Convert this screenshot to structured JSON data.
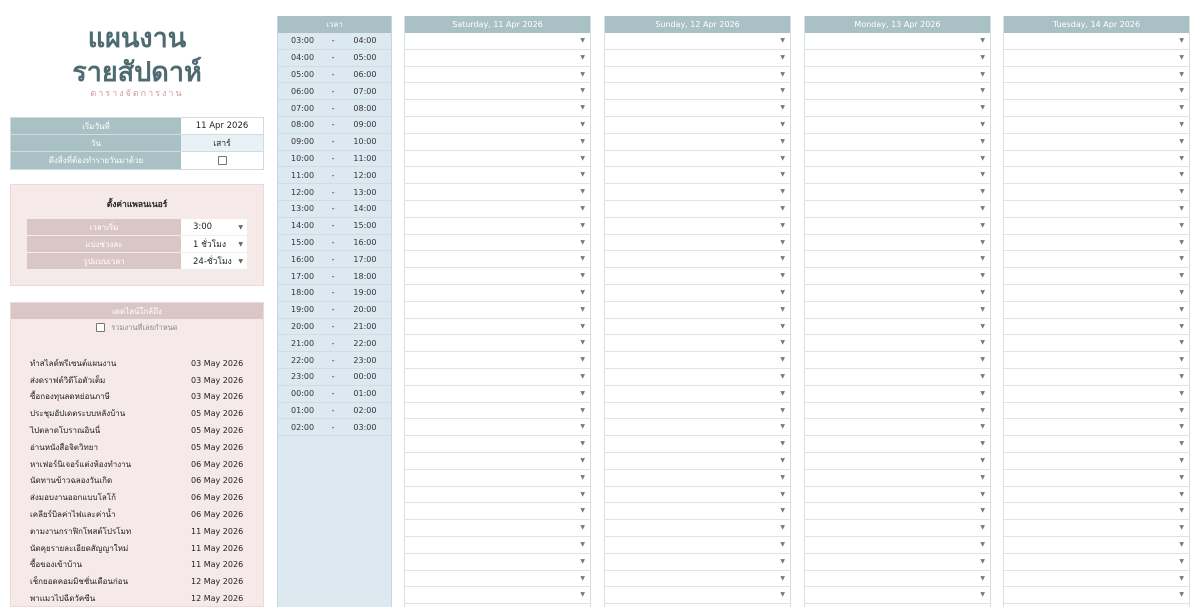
{
  "header": {
    "title_line1": "แผนงาน",
    "title_line2": "รายสัปดาห์",
    "subtitle": "ตารางจัดการงาน"
  },
  "info": {
    "start_label": "เริ่มวันที่",
    "start_value": "11 Apr 2026",
    "day_label": "วัน",
    "day_value": "เสาร์",
    "include_label": "ดึงสิ่งที่ต้องทำรายวันมาด้วย"
  },
  "settings": {
    "title": "ตั้งค่าแพลนเนอร์",
    "rows": [
      {
        "label": "เวลาเริ่ม",
        "value": "3:00"
      },
      {
        "label": "แบ่งช่วงละ",
        "value": "1 ชั่วโมง"
      },
      {
        "label": "รูปแบบเวลา",
        "value": "24-ชั่วโมง"
      }
    ]
  },
  "deadlines": {
    "title": "เดดไลน์ใกล้ถึง",
    "include_all_label": "รวมงานที่เลยกำหนด",
    "items": [
      {
        "task": "ทำสไลด์พรีเซนต์แผนงาน",
        "date": "03 May 2026"
      },
      {
        "task": "ส่งดราฟต์วิดีโอตัวเต็ม",
        "date": "03 May 2026"
      },
      {
        "task": "ซื้อกองทุนลดหย่อนภาษี",
        "date": "03 May 2026"
      },
      {
        "task": "ประชุมอัปเดตระบบหลังบ้าน",
        "date": "05 May 2026"
      },
      {
        "task": "ไปตลาดโบราณอินนี่",
        "date": "05 May 2026"
      },
      {
        "task": "อ่านหนังสือจิตวิทยา",
        "date": "05 May 2026"
      },
      {
        "task": "หาเฟอร์นิเจอร์แต่งห้องทำงาน",
        "date": "06 May 2026"
      },
      {
        "task": "นัดทานข้าวฉลองวันเกิด",
        "date": "06 May 2026"
      },
      {
        "task": "ส่งมอบงานออกแบบโลโก้",
        "date": "06 May 2026"
      },
      {
        "task": "เคลียร์บิลค่าไฟและค่าน้ำ",
        "date": "06 May 2026"
      },
      {
        "task": "ตามงานกราฟิกโพสต์โปรโมท",
        "date": "11 May 2026"
      },
      {
        "task": "นัดคุยรายละเอียดสัญญาใหม่",
        "date": "11 May 2026"
      },
      {
        "task": "ซื้อของเข้าบ้าน",
        "date": "11 May 2026"
      },
      {
        "task": "เช็กยอดคอมมิชชั่นเดือนก่อน",
        "date": "12 May 2026"
      },
      {
        "task": "พาแมวไปฉีดวัคซีน",
        "date": "12 May 2026"
      }
    ]
  },
  "time": {
    "header": "เวลา",
    "separator": "-",
    "rows": [
      [
        "03:00",
        "04:00"
      ],
      [
        "04:00",
        "05:00"
      ],
      [
        "05:00",
        "06:00"
      ],
      [
        "06:00",
        "07:00"
      ],
      [
        "07:00",
        "08:00"
      ],
      [
        "08:00",
        "09:00"
      ],
      [
        "09:00",
        "10:00"
      ],
      [
        "10:00",
        "11:00"
      ],
      [
        "11:00",
        "12:00"
      ],
      [
        "12:00",
        "13:00"
      ],
      [
        "13:00",
        "14:00"
      ],
      [
        "14:00",
        "15:00"
      ],
      [
        "15:00",
        "16:00"
      ],
      [
        "16:00",
        "17:00"
      ],
      [
        "17:00",
        "18:00"
      ],
      [
        "18:00",
        "19:00"
      ],
      [
        "19:00",
        "20:00"
      ],
      [
        "20:00",
        "21:00"
      ],
      [
        "21:00",
        "22:00"
      ],
      [
        "22:00",
        "23:00"
      ],
      [
        "23:00",
        "00:00"
      ],
      [
        "00:00",
        "01:00"
      ],
      [
        "01:00",
        "02:00"
      ],
      [
        "02:00",
        "03:00"
      ]
    ]
  },
  "days": [
    "Saturday, 11 Apr 2026",
    "Sunday, 12 Apr 2026",
    "Monday, 13 Apr 2026",
    "Tuesday, 14 Apr 2026"
  ],
  "icons": {
    "dropdown": "chevron-down-icon",
    "checkbox": "checkbox-icon"
  },
  "colors": {
    "title": "#4f6b72",
    "header_teal": "#a9c0c4",
    "pink_panel": "#f6e9e9",
    "time_bg": "#dde9f0"
  }
}
